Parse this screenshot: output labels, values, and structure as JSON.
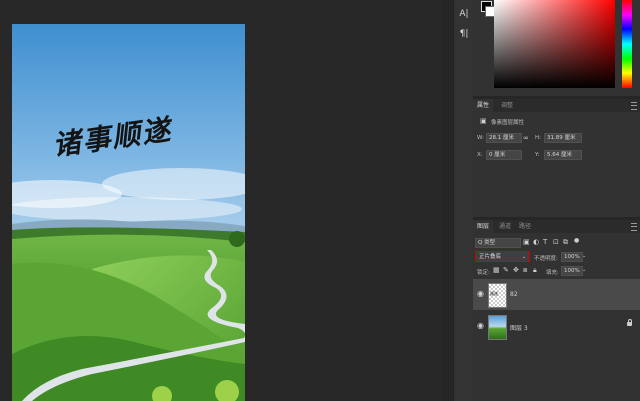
{
  "toolstrip": {
    "icons": [
      "character-icon",
      "paragraph-icon"
    ],
    "glyphs": [
      "A|",
      "¶|"
    ]
  },
  "properties": {
    "tab_properties": "属性",
    "tab_adjustments": "调整",
    "section_title": "像素图层属性",
    "w_label": "W:",
    "w_value": "28.1 厘米",
    "link_glyph": "∞",
    "h_label": "H:",
    "h_value": "31.89 厘米",
    "x_label": "X:",
    "x_value": "0 厘米",
    "y_label": "Y:",
    "y_value": "5.64 厘米"
  },
  "layers": {
    "tab_layers": "图层",
    "tab_channels": "通道",
    "tab_paths": "路径",
    "filter_kind": "Q 类型",
    "blend_mode": "正片叠底",
    "opacity_label": "不透明度:",
    "opacity_value": "100%",
    "lock_label": "锁定:",
    "fill_label": "填充:",
    "fill_value": "100%",
    "items": [
      {
        "name": "82",
        "thumb_text": "顺遂"
      },
      {
        "name": "图层 3"
      }
    ]
  },
  "document": {
    "calligraphy": "诸事顺遂"
  },
  "colors": {
    "app_bg": "#262626",
    "panel_bg": "#323232",
    "selection_red": "#d40000"
  }
}
